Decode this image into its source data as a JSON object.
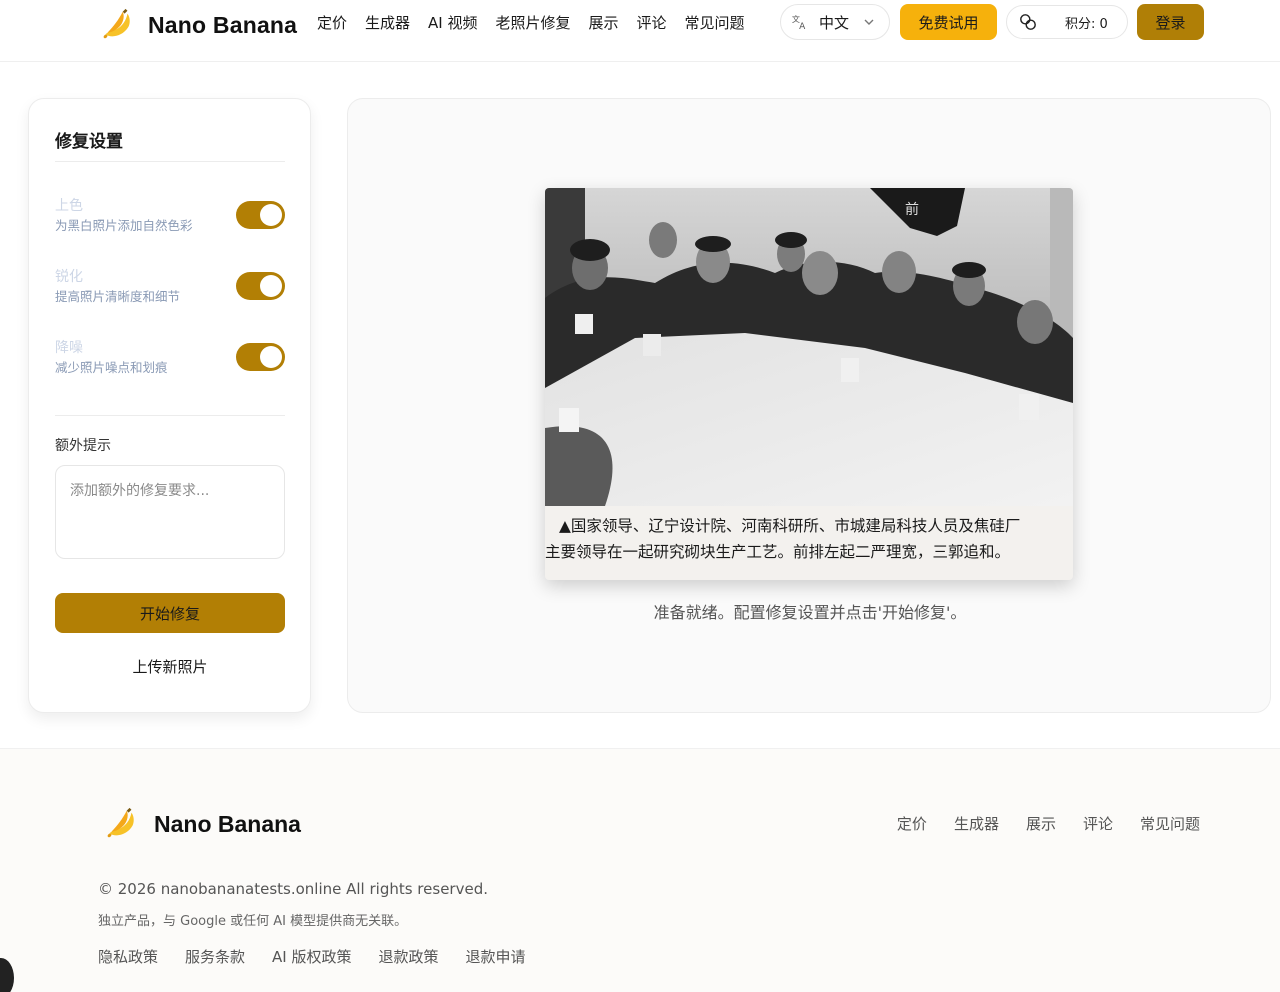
{
  "header": {
    "brand": "Nano Banana",
    "nav": [
      "定价",
      "生成器",
      "AI 视频",
      "老照片修复",
      "展示",
      "评论",
      "常见问题"
    ],
    "language": "中文",
    "trial_button": "免费试用",
    "credits": "积分: 0",
    "login_button": "登录"
  },
  "settings": {
    "title": "修复设置",
    "options": [
      {
        "title": "上色",
        "desc": "为黑白照片添加自然色彩",
        "enabled": true
      },
      {
        "title": "锐化",
        "desc": "提高照片清晰度和细节",
        "enabled": true
      },
      {
        "title": "降噪",
        "desc": "减少照片噪点和划痕",
        "enabled": true
      }
    ],
    "extra_label": "额外提示",
    "extra_placeholder": "添加额外的修复要求...",
    "start_button": "开始修复",
    "upload_button": "上传新照片"
  },
  "preview": {
    "caption_line1": "▲国家领导、辽宁设计院、河南科研所、市城建局科技人员及焦硅厂",
    "caption_line2": "主要领导在一起研究砌块生产工艺。前排左起二严理宽，三郭追和。",
    "status": "准备就绪。配置修复设置并点击'开始修复'。"
  },
  "footer": {
    "brand": "Nano Banana",
    "nav": [
      "定价",
      "生成器",
      "展示",
      "评论",
      "常见问题"
    ],
    "copyright": "© 2026 nanobananatests.online All rights reserved.",
    "disclaimer": "独立产品，与 Google 或任何 AI 模型提供商无关联。",
    "links": [
      "隐私政策",
      "服务条款",
      "AI 版权政策",
      "退款政策",
      "退款申请"
    ]
  },
  "colors": {
    "accent_yellow": "#f6b10c",
    "accent_dark": "#b27f05"
  },
  "icons": [
    "banana-logo-icon",
    "translate-icon",
    "chevron-down-icon",
    "coins-icon"
  ]
}
